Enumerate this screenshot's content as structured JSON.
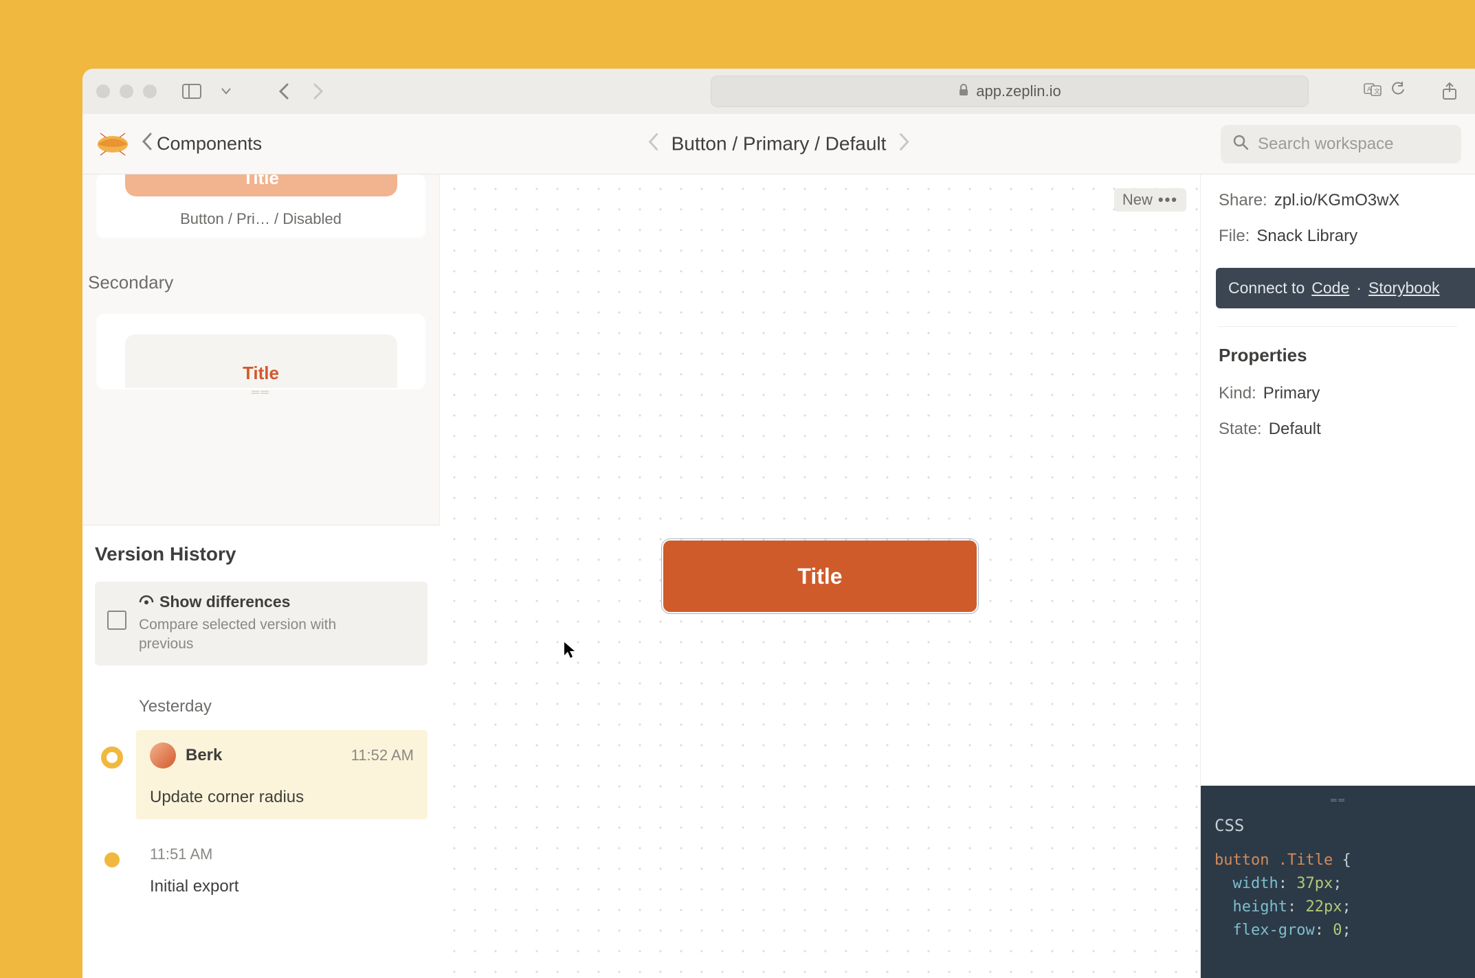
{
  "browser": {
    "url_host": "app.zeplin.io"
  },
  "header": {
    "back_label": "Components",
    "breadcrumb": "Button / Primary / Default",
    "search_placeholder": "Search workspace"
  },
  "sidebar": {
    "thumb_disabled": {
      "button_text": "Title",
      "caption": "Button / Pri… / Disabled"
    },
    "section_secondary_label": "Secondary",
    "thumb_secondary": {
      "button_text": "Title"
    }
  },
  "version_history": {
    "title": "Version History",
    "show_diff": {
      "title": "Show differences",
      "subtitle": "Compare selected version with previous"
    },
    "group_label": "Yesterday",
    "items": [
      {
        "author": "Berk",
        "time": "11:52 AM",
        "message": "Update corner radius",
        "selected": true
      },
      {
        "time_only": "11:51 AM",
        "message": "Initial export",
        "selected": false
      }
    ]
  },
  "canvas": {
    "new_chip": "New",
    "component_text": "Title"
  },
  "inspector": {
    "share_label": "Share:",
    "share_value": "zpl.io/KGmO3wX",
    "file_label": "File:",
    "file_value": "Snack Library",
    "connect_prefix": "Connect to",
    "connect_code": "Code",
    "connect_sep": "·",
    "connect_storybook": "Storybook",
    "properties_title": "Properties",
    "kind_label": "Kind:",
    "kind_value": "Primary",
    "state_label": "State:",
    "state_value": "Default"
  },
  "code": {
    "lang": "CSS",
    "selector": "button .Title",
    "lines": [
      {
        "prop": "width",
        "val": "37px"
      },
      {
        "prop": "height",
        "val": "22px"
      },
      {
        "prop": "flex-grow",
        "val": "0"
      }
    ]
  }
}
